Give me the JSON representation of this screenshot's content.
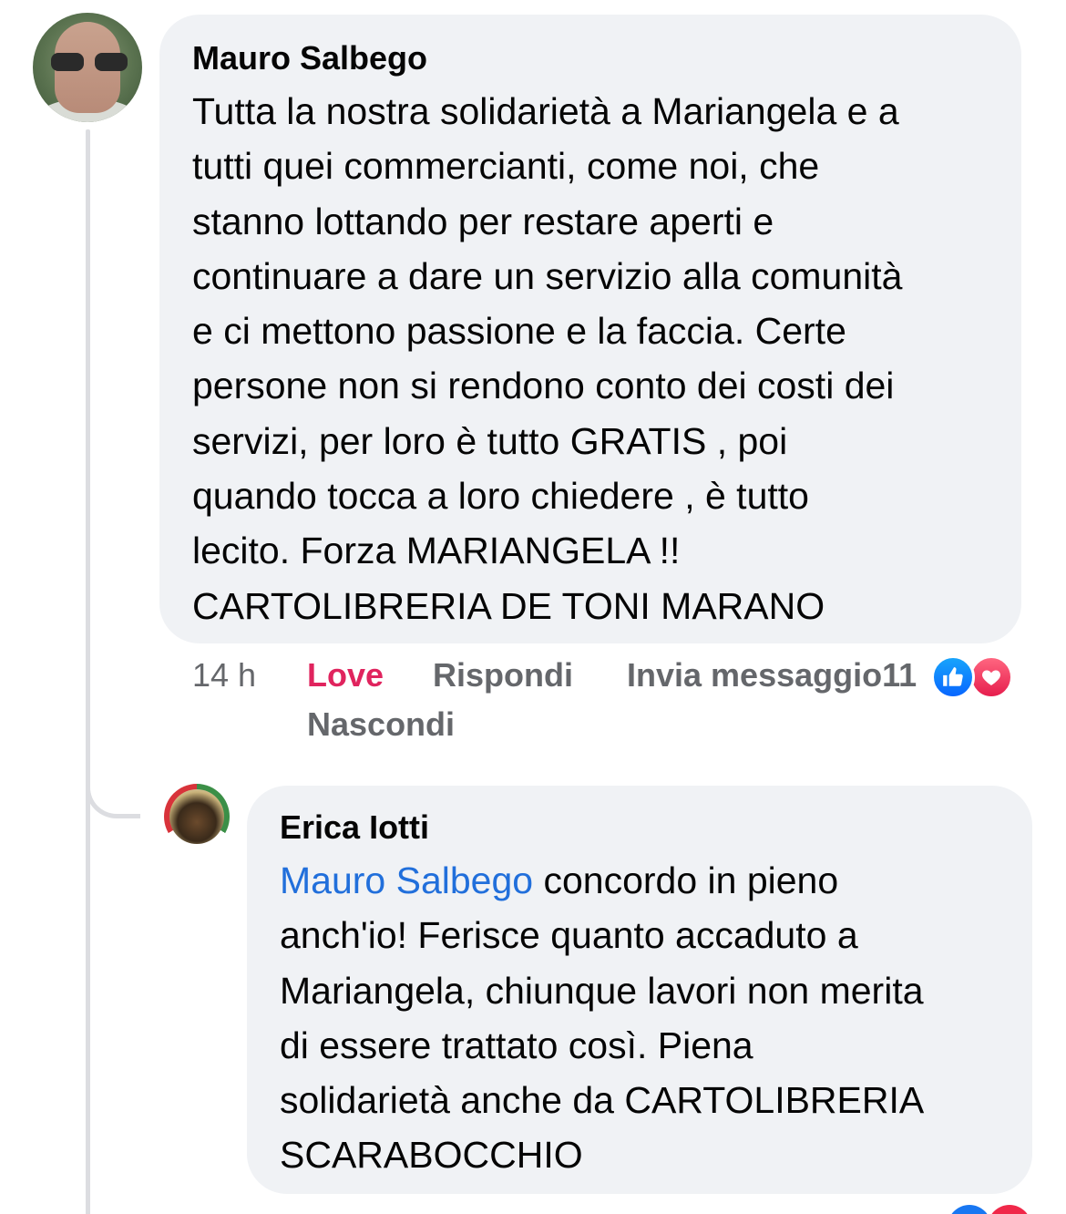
{
  "comment": {
    "author": "Mauro Salbego",
    "text": "Tutta la nostra solidarietà a Mariangela e a\ntutti quei commercianti, come noi, che\nstanno lottando per restare aperti e\ncontinuare a dare un servizio alla comunità\ne ci mettono passione e la faccia. Certe\npersone non si rendono conto dei costi dei\nservizi, per loro è tutto GRATIS , poi\nquando tocca a loro chiedere , è tutto\nlecito. Forza MARIANGELA !!\nCARTOLIBRERIA DE TONI MARANO",
    "time": "14 h",
    "love_label": "Love",
    "reply_label": "Rispondi",
    "message_label": "Invia messaggio",
    "reaction_count": "11",
    "hide_label": "Nascondi",
    "reactions": [
      "like-icon",
      "heart-icon"
    ]
  },
  "reply": {
    "author": "Erica Iotti",
    "mention": "Mauro Salbego",
    "text": " concordo in pieno\nanch'io! Ferisce quanto accaduto a\nMariangela, chiunque lavori non merita\ndi essere trattato così. Piena\nsolidarietà anche da CARTOLIBRERIA\nSCARABOCCHIO"
  },
  "colors": {
    "bubble": "#f0f2f5",
    "love": "#e0245e",
    "mention": "#216fdb",
    "secondary_text": "#65676b",
    "like": "#0866ff",
    "heart": "#e61e4d"
  }
}
